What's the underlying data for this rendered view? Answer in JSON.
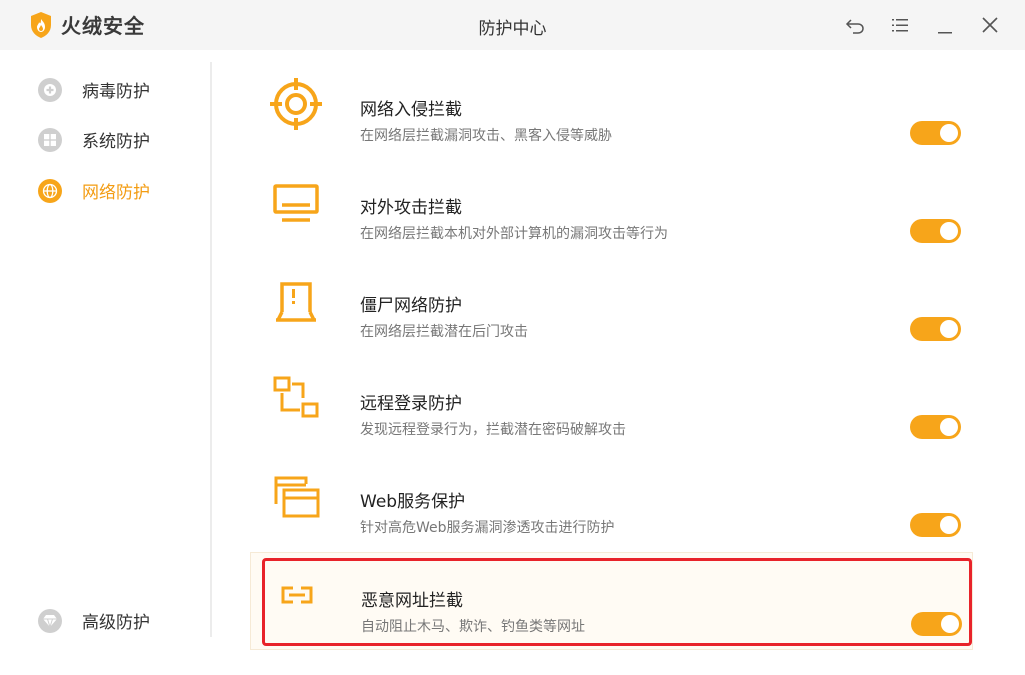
{
  "app": {
    "brand": "火绒安全",
    "window_title": "防护中心"
  },
  "titlebar": {
    "controls": [
      "back-icon",
      "menu-icon",
      "minimize-icon",
      "close-icon"
    ]
  },
  "sidebar": {
    "items": [
      {
        "label": "病毒防护",
        "icon": "plus-shield-icon",
        "active": false
      },
      {
        "label": "系统防护",
        "icon": "windows-icon",
        "active": false
      },
      {
        "label": "网络防护",
        "icon": "globe-icon",
        "active": true
      },
      {
        "label": "高级防护",
        "icon": "diamond-icon",
        "active": false
      }
    ]
  },
  "protections": [
    {
      "title": "网络入侵拦截",
      "desc": "在网络层拦截漏洞攻击、黑客入侵等威胁",
      "icon": "target-icon",
      "enabled": true
    },
    {
      "title": "对外攻击拦截",
      "desc": "在网络层拦截本机对外部计算机的漏洞攻击等行为",
      "icon": "monitor-icon",
      "enabled": true
    },
    {
      "title": "僵尸网络防护",
      "desc": "在网络层拦截潜在后门攻击",
      "icon": "laptop-alert-icon",
      "enabled": true
    },
    {
      "title": "远程登录防护",
      "desc": "发现远程登录行为，拦截潜在密码破解攻击",
      "icon": "remote-link-icon",
      "enabled": true
    },
    {
      "title": "Web服务保护",
      "desc": "针对高危Web服务漏洞渗透攻击进行防护",
      "icon": "browser-windows-icon",
      "enabled": true
    },
    {
      "title": "恶意网址拦截",
      "desc": "自动阻止木马、欺诈、钓鱼类等网址",
      "icon": "link-icon",
      "enabled": true,
      "highlighted": true
    }
  ],
  "colors": {
    "accent": "#f7a51a",
    "active_text": "#f39c12",
    "highlight_border": "#e8232a"
  }
}
